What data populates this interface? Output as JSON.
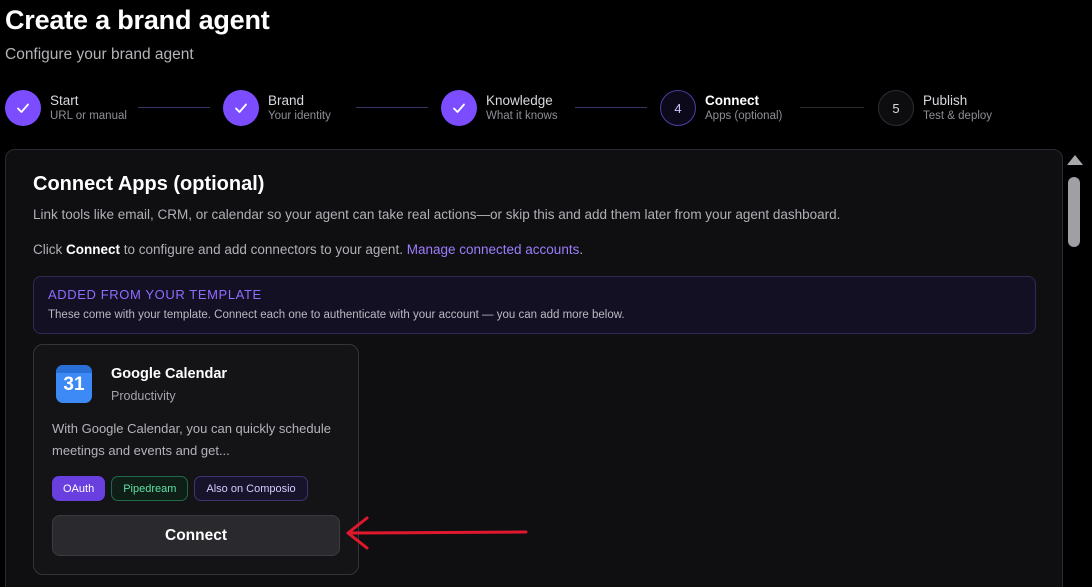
{
  "header": {
    "title": "Create a brand agent",
    "subtitle": "Configure your brand agent"
  },
  "stepper": {
    "steps": [
      {
        "label": "Start",
        "sub": "URL or manual",
        "state": "done",
        "number": "1"
      },
      {
        "label": "Brand",
        "sub": "Your identity",
        "state": "done",
        "number": "2"
      },
      {
        "label": "Knowledge",
        "sub": "What it knows",
        "state": "done",
        "number": "3"
      },
      {
        "label": "Connect",
        "sub": "Apps (optional)",
        "state": "current",
        "number": "4"
      },
      {
        "label": "Publish",
        "sub": "Test & deploy",
        "state": "upcoming",
        "number": "5"
      }
    ]
  },
  "panel": {
    "title": "Connect Apps (optional)",
    "description": "Link tools like email, CRM, or calendar so your agent can take real actions—or skip this and add them later from your agent dashboard.",
    "note_prefix": "Click ",
    "note_bold": "Connect",
    "note_middle": " to configure and add connectors to your agent. ",
    "note_link": "Manage connected accounts",
    "note_suffix": ".",
    "template": {
      "heading": "ADDED FROM YOUR TEMPLATE",
      "text": "These come with your template. Connect each one to authenticate with your account — you can add more below."
    }
  },
  "apps": [
    {
      "name": "Google Calendar",
      "category": "Productivity",
      "icon": "google-calendar-icon",
      "icon_text": "31",
      "description": "With Google Calendar, you can quickly schedule meetings and events and get...",
      "tags": [
        "OAuth",
        "Pipedream",
        "Also on Composio"
      ],
      "button_label": "Connect"
    }
  ],
  "colors": {
    "accent": "#7c4dff",
    "background": "#000000",
    "panel": "#0f0f12",
    "annotation_arrow": "#e0182d"
  }
}
